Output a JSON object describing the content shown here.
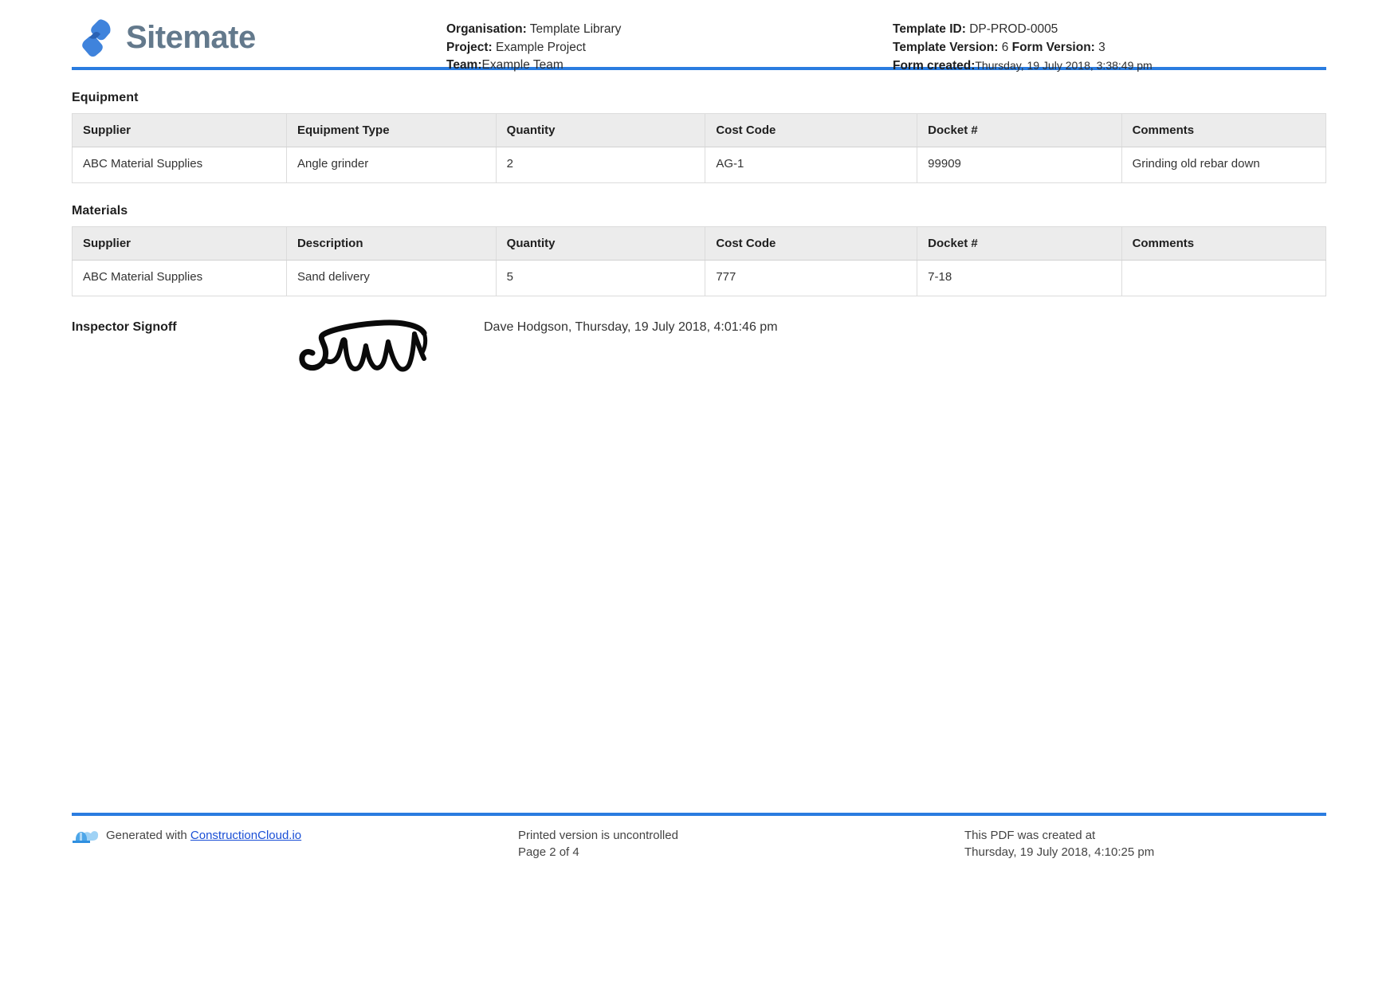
{
  "brand": {
    "name": "Sitemate",
    "logo_icon": "sitemate-logo-icon"
  },
  "header": {
    "organisation_label": "Organisation:",
    "organisation_value": "Template Library",
    "project_label": "Project:",
    "project_value": "Example Project",
    "team_label": "Team:",
    "team_value": "Example Team",
    "template_id_label": "Template ID:",
    "template_id_value": "DP-PROD-0005",
    "template_version_label": "Template Version:",
    "template_version_value": "6",
    "form_version_label": "Form Version:",
    "form_version_value": "3",
    "form_created_label": "Form created:",
    "form_created_value": "Thursday, 19 July 2018, 3:38:49 pm"
  },
  "equipment": {
    "title": "Equipment",
    "columns": [
      "Supplier",
      "Equipment Type",
      "Quantity",
      "Cost Code",
      "Docket #",
      "Comments"
    ],
    "rows": [
      [
        "ABC Material Supplies",
        "Angle grinder",
        "2",
        "AG-1",
        "99909",
        "Grinding old rebar down"
      ]
    ]
  },
  "materials": {
    "title": "Materials",
    "columns": [
      "Supplier",
      "Description",
      "Quantity",
      "Cost Code",
      "Docket #",
      "Comments"
    ],
    "rows": [
      [
        "ABC Material Supplies",
        "Sand delivery",
        "5",
        "777",
        "7-18",
        ""
      ]
    ]
  },
  "signoff": {
    "label": "Inspector Signoff",
    "signature_icon": "handwritten-signature",
    "signed_by": "Dave Hodgson, Thursday, 19 July 2018, 4:01:46 pm"
  },
  "footer": {
    "logo_icon": "constructioncloud-hardhat-icon",
    "generated_with_label": "Generated with",
    "generated_with_link": "ConstructionCloud.io",
    "uncontrolled_notice": "Printed version is uncontrolled",
    "page_number": "Page 2 of 4",
    "created_at_label": "This PDF was created at",
    "created_at_value": "Thursday, 19 July 2018, 4:10:25 pm"
  },
  "colors": {
    "accent_blue": "#2a7ce0",
    "brand_gray": "#63798c",
    "link_blue": "#1a4fd6",
    "header_row": "#ececec"
  }
}
